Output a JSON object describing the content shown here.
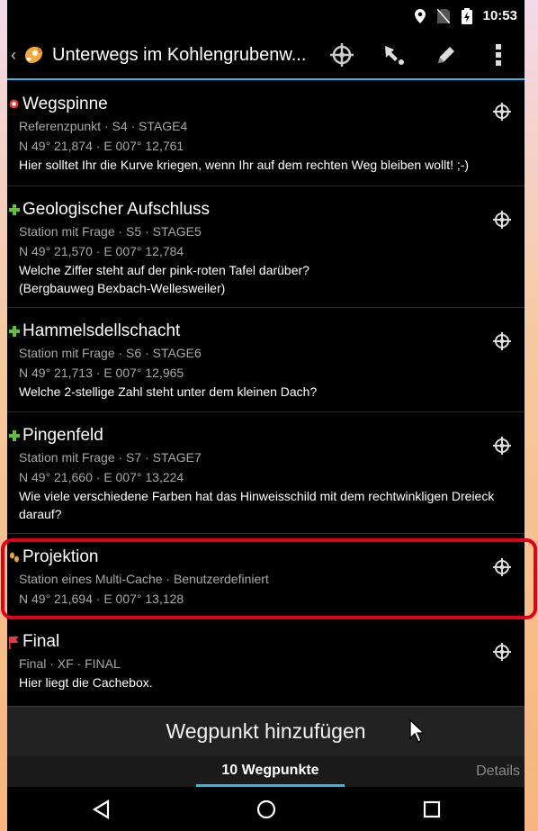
{
  "status": {
    "time": "10:53"
  },
  "actionbar": {
    "title": "Unterwegs im Kohlengrubenw..."
  },
  "waypoints": [
    {
      "name": "Wegspinne",
      "sub": "Referenzpunkt · S4 · STAGE4",
      "coords": "N 49° 21,874 · E 007° 12,761",
      "note": "Hier solltet Ihr die Kurve kriegen, wenn Ihr auf dem rechten Weg bleiben wollt! ;-)",
      "icon": "reference-point-icon"
    },
    {
      "name": "Geologischer Aufschluss",
      "sub": "Station mit Frage · S5 · STAGE5",
      "coords": "N 49° 21,570 · E 007° 12,784",
      "note": "Welche Ziffer steht auf der pink-roten Tafel darüber? (Bergbauweg Bexbach-Wellesweiler)",
      "icon": "question-station-icon"
    },
    {
      "name": "Hammelsdellschacht",
      "sub": "Station mit Frage · S6 · STAGE6",
      "coords": "N 49° 21,713 · E 007° 12,965",
      "note": "Welche 2-stellige Zahl steht unter dem kleinen Dach?",
      "icon": "question-station-icon"
    },
    {
      "name": "Pingenfeld",
      "sub": "Station mit Frage · S7 · STAGE7",
      "coords": "N 49° 21,660 · E 007° 13,224",
      "note": "Wie viele verschiedene Farben hat das Hinweisschild mit dem rechtwinkligen Dreieck darauf?",
      "icon": "question-station-icon"
    },
    {
      "name": "Projektion",
      "sub": "Station eines Multi-Cache · Benutzerdefiniert",
      "coords": "N 49° 21,694 · E 007° 13,128",
      "note": "",
      "icon": "multi-cache-stage-icon"
    },
    {
      "name": "Final",
      "sub": "Final · XF · FINAL",
      "coords": "",
      "note": "Hier liegt die Cachebox.",
      "icon": "final-flag-icon"
    }
  ],
  "add_button": {
    "label": "Wegpunkt hinzufügen"
  },
  "tabs": {
    "active": "10 Wegpunkte",
    "details": "Details"
  },
  "colors": {
    "accent": "#33b5e5",
    "highlight": "#e0001a"
  }
}
